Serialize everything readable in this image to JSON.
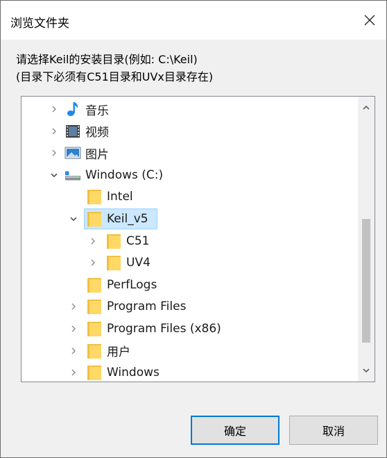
{
  "window": {
    "title": "浏览文件夹",
    "close_label": "×"
  },
  "instructions": {
    "line1": "请选择Keil的安装目录(例如: C:\\Keil)",
    "line2": "(目录下必须有C51目录和UVx目录存在)"
  },
  "tree": {
    "items": [
      {
        "label": "音乐",
        "icon": "music-note-icon",
        "expander": "collapsed",
        "level": 0
      },
      {
        "label": "视频",
        "icon": "video-icon",
        "expander": "collapsed",
        "level": 0
      },
      {
        "label": "图片",
        "icon": "picture-icon",
        "expander": "collapsed",
        "level": 0
      },
      {
        "label": "Windows (C:)",
        "icon": "drive-icon",
        "expander": "expanded",
        "level": 0
      },
      {
        "label": "Intel",
        "icon": "folder-icon",
        "expander": "none",
        "level": 1
      },
      {
        "label": "Keil_v5",
        "icon": "folder-icon",
        "expander": "expanded",
        "level": 1,
        "selected": true
      },
      {
        "label": "C51",
        "icon": "folder-icon",
        "expander": "collapsed",
        "level": 2
      },
      {
        "label": "UV4",
        "icon": "folder-icon",
        "expander": "collapsed",
        "level": 2
      },
      {
        "label": "PerfLogs",
        "icon": "folder-icon",
        "expander": "none",
        "level": 1
      },
      {
        "label": "Program Files",
        "icon": "folder-icon",
        "expander": "collapsed",
        "level": 1
      },
      {
        "label": "Program Files (x86)",
        "icon": "folder-icon",
        "expander": "collapsed",
        "level": 1
      },
      {
        "label": "用户",
        "icon": "folder-icon",
        "expander": "collapsed",
        "level": 1
      },
      {
        "label": "Windows",
        "icon": "folder-icon",
        "expander": "collapsed",
        "level": 1
      }
    ]
  },
  "buttons": {
    "ok": "确定",
    "cancel": "取消"
  },
  "colors": {
    "accent": "#0078d7",
    "selection_bg": "#cce8ff",
    "folder": "#ffd865"
  }
}
